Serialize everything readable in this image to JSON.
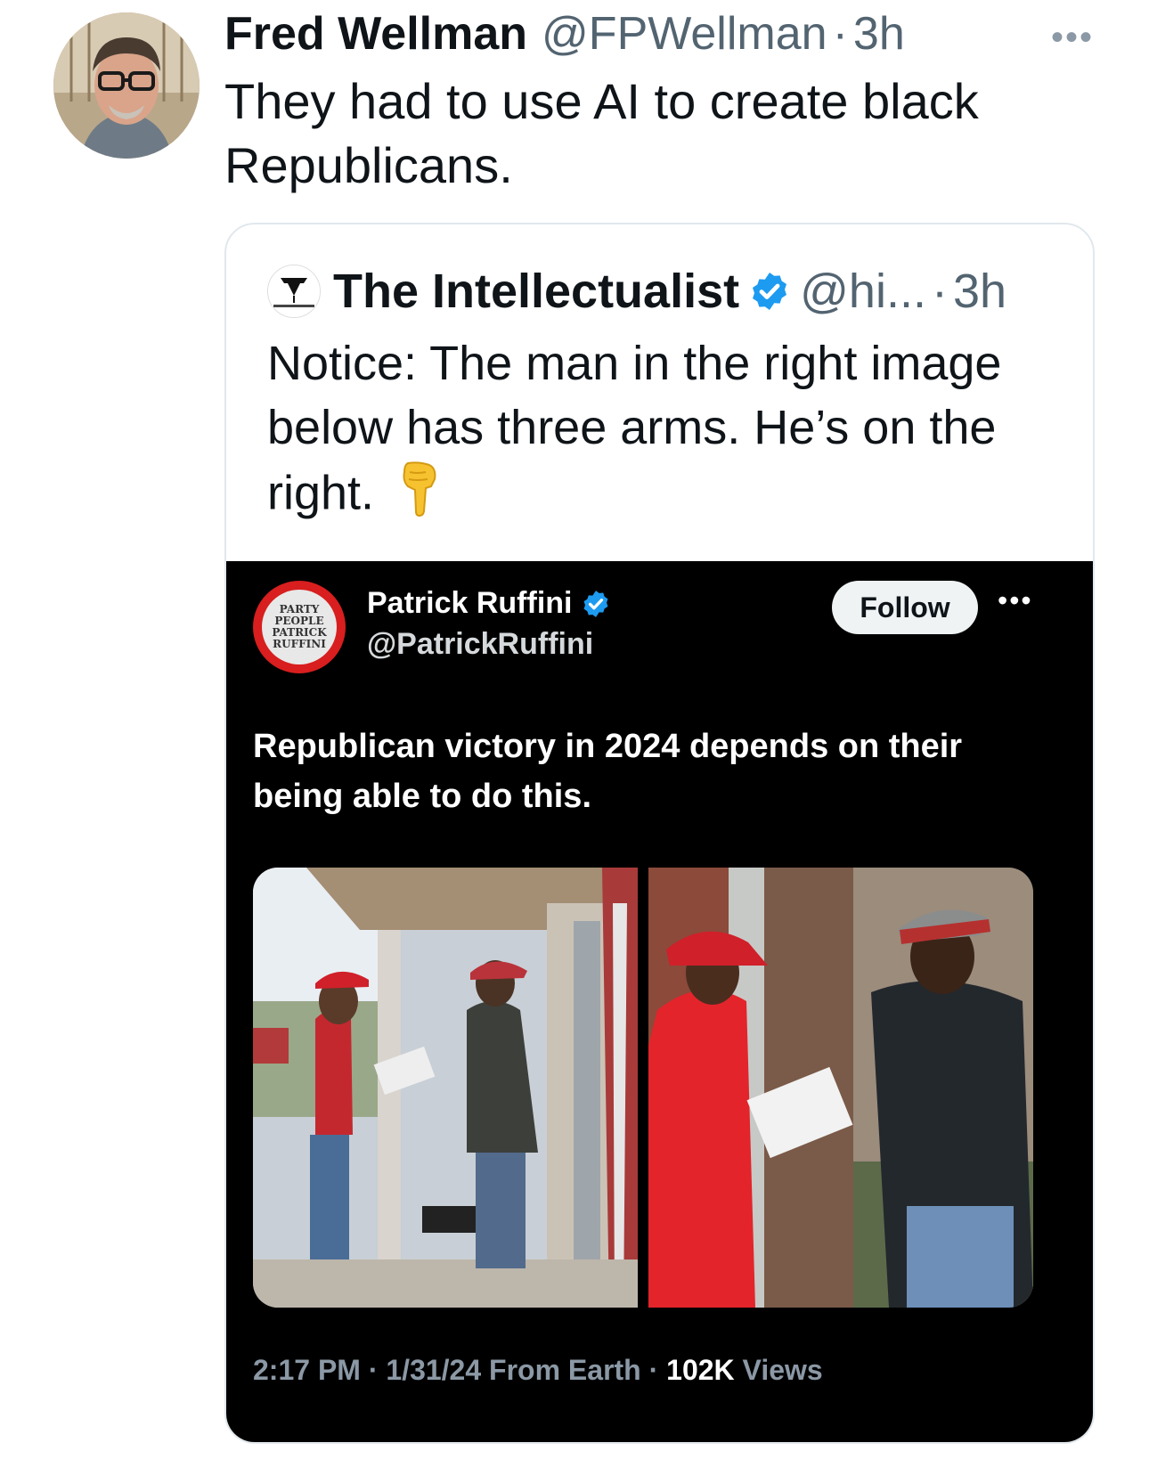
{
  "tweet": {
    "author_name": "Fred Wellman",
    "author_handle": "@FPWellman",
    "separator": "·",
    "time": "3h",
    "more_icon": "more-horizontal-icon",
    "text": "They had to use AI to create black Republicans."
  },
  "quoted_tweet": {
    "author_name": "The Intellectualist",
    "author_handle": "@hi...",
    "separator": "·",
    "time": "3h",
    "verified_color": "#1d9bf0",
    "text": "Notice: The man in the right image below has three arms. He’s on the right.",
    "emoji": "backhand-index-pointing-down-icon"
  },
  "embedded_post": {
    "author_name": "Patrick Ruffini",
    "author_handle": "@PatrickRuffini",
    "follow_label": "Follow",
    "avatar_text": [
      "PARTY",
      "PEOPLE",
      "PATRICK",
      "RUFFINI"
    ],
    "text": "Republican victory in 2024 depends on their being able to do this.",
    "footer": {
      "time": "2:17 PM",
      "date": "1/31/24",
      "source": "From Earth",
      "views_count": "102K",
      "views_label": "Views"
    }
  },
  "colors": {
    "text_primary": "#0f1419",
    "text_secondary": "#536471",
    "embed_bg": "#000000",
    "cap_red": "#d0202a"
  }
}
